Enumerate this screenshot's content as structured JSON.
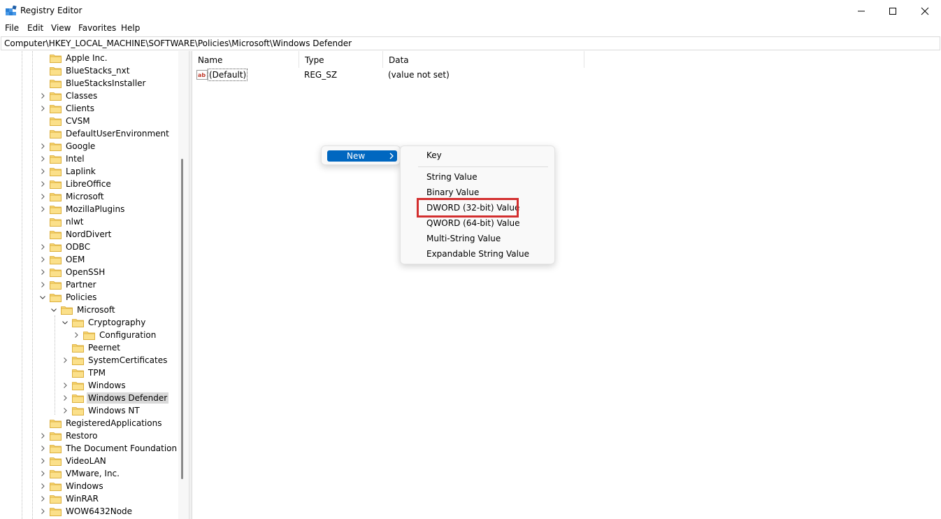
{
  "window": {
    "title": "Registry Editor",
    "icon": "registry-editor-icon",
    "controls": [
      "minimize-icon",
      "maximize-icon",
      "close-icon"
    ]
  },
  "menubar": {
    "items": [
      "File",
      "Edit",
      "View",
      "Favorites",
      "Help"
    ]
  },
  "address": {
    "path": "Computer\\HKEY_LOCAL_MACHINE\\SOFTWARE\\Policies\\Microsoft\\Windows Defender"
  },
  "tree": {
    "items": [
      {
        "label": "Apple Inc.",
        "level": 0,
        "expander": "none"
      },
      {
        "label": "BlueStacks_nxt",
        "level": 0,
        "expander": "none"
      },
      {
        "label": "BlueStacksInstaller",
        "level": 0,
        "expander": "none"
      },
      {
        "label": "Classes",
        "level": 0,
        "expander": "collapsed"
      },
      {
        "label": "Clients",
        "level": 0,
        "expander": "collapsed"
      },
      {
        "label": "CVSM",
        "level": 0,
        "expander": "none"
      },
      {
        "label": "DefaultUserEnvironment",
        "level": 0,
        "expander": "none"
      },
      {
        "label": "Google",
        "level": 0,
        "expander": "collapsed"
      },
      {
        "label": "Intel",
        "level": 0,
        "expander": "collapsed"
      },
      {
        "label": "Laplink",
        "level": 0,
        "expander": "collapsed"
      },
      {
        "label": "LibreOffice",
        "level": 0,
        "expander": "collapsed"
      },
      {
        "label": "Microsoft",
        "level": 0,
        "expander": "collapsed"
      },
      {
        "label": "MozillaPlugins",
        "level": 0,
        "expander": "collapsed"
      },
      {
        "label": "nlwt",
        "level": 0,
        "expander": "none"
      },
      {
        "label": "NordDivert",
        "level": 0,
        "expander": "none"
      },
      {
        "label": "ODBC",
        "level": 0,
        "expander": "collapsed"
      },
      {
        "label": "OEM",
        "level": 0,
        "expander": "collapsed"
      },
      {
        "label": "OpenSSH",
        "level": 0,
        "expander": "collapsed"
      },
      {
        "label": "Partner",
        "level": 0,
        "expander": "collapsed"
      },
      {
        "label": "Policies",
        "level": 0,
        "expander": "expanded"
      },
      {
        "label": "Microsoft",
        "level": 1,
        "expander": "expanded"
      },
      {
        "label": "Cryptography",
        "level": 2,
        "expander": "expanded"
      },
      {
        "label": "Configuration",
        "level": 3,
        "expander": "collapsed"
      },
      {
        "label": "Peernet",
        "level": 2,
        "expander": "none"
      },
      {
        "label": "SystemCertificates",
        "level": 2,
        "expander": "collapsed"
      },
      {
        "label": "TPM",
        "level": 2,
        "expander": "none"
      },
      {
        "label": "Windows",
        "level": 2,
        "expander": "collapsed"
      },
      {
        "label": "Windows Defender",
        "level": 2,
        "expander": "collapsed",
        "selected": true
      },
      {
        "label": "Windows NT",
        "level": 2,
        "expander": "collapsed"
      },
      {
        "label": "RegisteredApplications",
        "level": 0,
        "expander": "none"
      },
      {
        "label": "Restoro",
        "level": 0,
        "expander": "collapsed"
      },
      {
        "label": "The Document Foundation",
        "level": 0,
        "expander": "collapsed"
      },
      {
        "label": "VideoLAN",
        "level": 0,
        "expander": "collapsed"
      },
      {
        "label": "VMware, Inc.",
        "level": 0,
        "expander": "collapsed"
      },
      {
        "label": "Windows",
        "level": 0,
        "expander": "collapsed"
      },
      {
        "label": "WinRAR",
        "level": 0,
        "expander": "collapsed"
      },
      {
        "label": "WOW6432Node",
        "level": 0,
        "expander": "collapsed"
      }
    ]
  },
  "list": {
    "columns": [
      "Name",
      "Type",
      "Data"
    ],
    "rows": [
      {
        "name": "(Default)",
        "type": "REG_SZ",
        "data": "(value not set)",
        "icon": "string-value-icon"
      }
    ]
  },
  "context_menu": {
    "new_label": "New",
    "submenu": {
      "items": [
        "Key",
        "String Value",
        "Binary Value",
        "DWORD (32-bit) Value",
        "QWORD (64-bit) Value",
        "Multi-String Value",
        "Expandable String Value"
      ],
      "highlighted": "DWORD (32-bit) Value"
    }
  },
  "colors": {
    "accent": "#0067c0",
    "highlight_box": "#d32f2f",
    "folder": "#f8d775",
    "selected_row": "#d9d9d9"
  }
}
